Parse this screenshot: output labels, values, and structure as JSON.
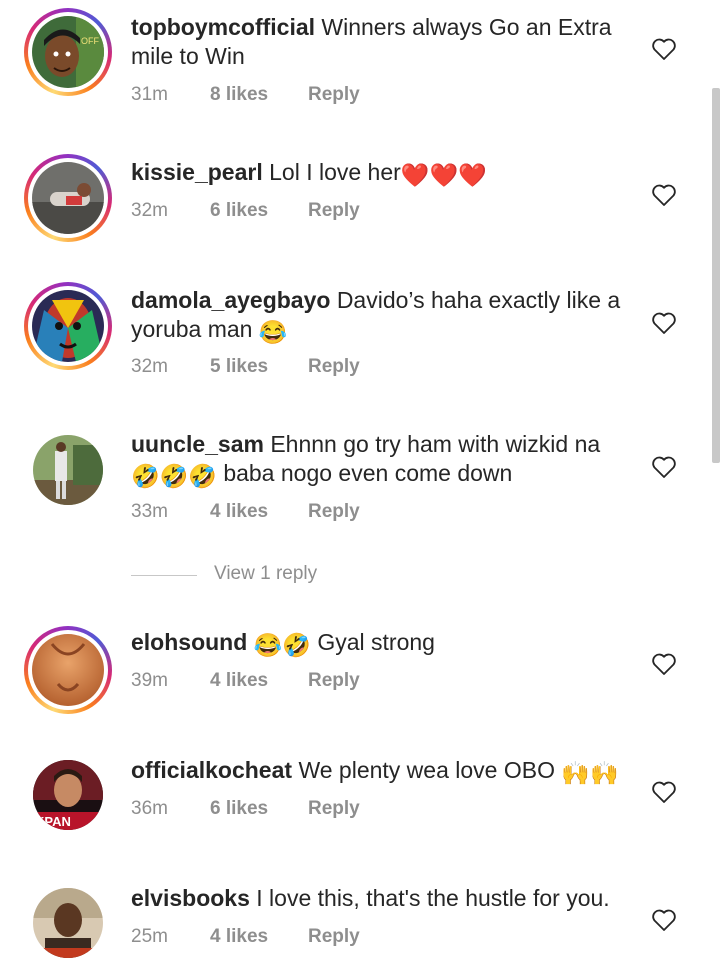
{
  "comments": [
    {
      "username": "topboymcofficial",
      "text": "Winners always Go an Extra mile to Win",
      "time": "31m",
      "likes": "8 likes",
      "reply": "Reply",
      "avatar": "avatar-cartoon"
    },
    {
      "username": "kissie_pearl",
      "text": "Lol I love her",
      "emoji": "❤️❤️❤️",
      "time": "32m",
      "likes": "6 likes",
      "reply": "Reply",
      "avatar": "avatar-photo"
    },
    {
      "username": "damola_ayegbayo",
      "text": "Davido’s haha exactly like a yoruba man",
      "emoji": "😂",
      "time": "32m",
      "likes": "5 likes",
      "reply": "Reply",
      "avatar": "avatar-painted-face"
    },
    {
      "username": "uuncle_sam",
      "text": "Ehnnn go try ham with wizkid na",
      "emoji": "🤣🤣🤣",
      "text2": "baba nogo even come down",
      "time": "33m",
      "likes": "4 likes",
      "reply": "Reply",
      "avatar": "avatar-photo"
    },
    {
      "username": "elohsound",
      "emoji": "😂🤣",
      "text": "Gyal strong",
      "time": "39m",
      "likes": "4 likes",
      "reply": "Reply",
      "avatar": "avatar-photo"
    },
    {
      "username": "officialkocheat",
      "text": "We plenty wea love OBO",
      "emoji": "🙌🙌",
      "time": "36m",
      "likes": "6 likes",
      "reply": "Reply",
      "avatar": "avatar-photo",
      "avatar_text": "KPAN"
    },
    {
      "username": "elvisbooks",
      "text": "I love this, that's the hustle for you.",
      "time": "25m",
      "likes": "4 likes",
      "reply": "Reply",
      "avatar": "avatar-photo"
    }
  ],
  "view_replies": "View 1 reply",
  "colors": {
    "username": "#262626",
    "meta": "#8e8e8e",
    "heart": "#262626"
  }
}
